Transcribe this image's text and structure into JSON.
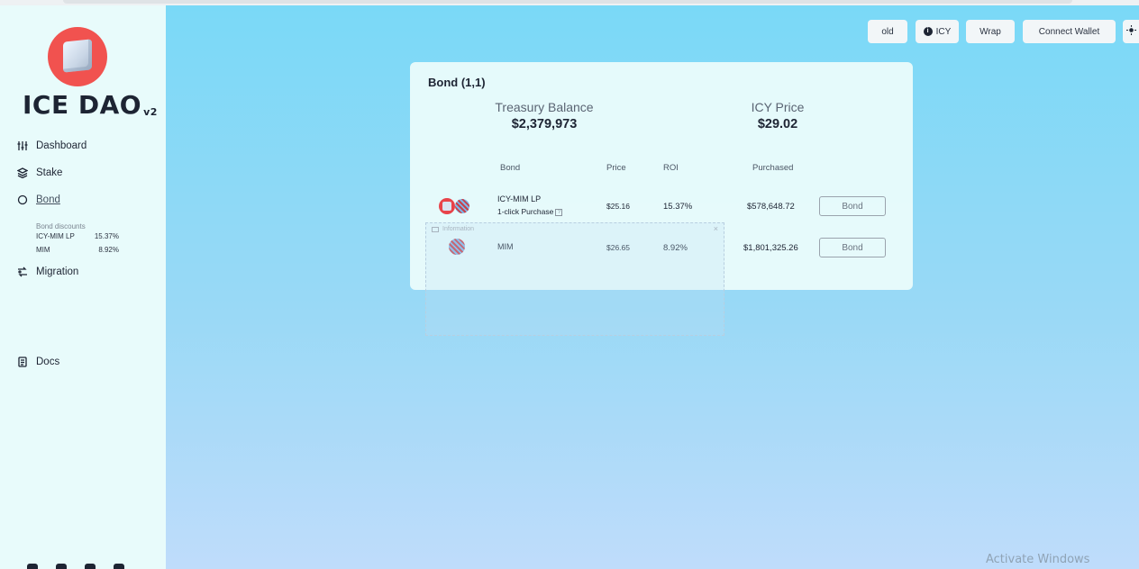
{
  "brand": {
    "name": "ICE DAO",
    "version": "v2"
  },
  "nav": {
    "dashboard": "Dashboard",
    "stake": "Stake",
    "bond": "Bond",
    "migration": "Migration",
    "docs": "Docs"
  },
  "bond_discounts": {
    "title": "Bond discounts",
    "items": [
      {
        "name": "ICY-MIM LP",
        "value": "15.37%"
      },
      {
        "name": "MIM",
        "value": "8.92%"
      }
    ]
  },
  "topbar": {
    "old": "old",
    "icy": "ICY",
    "wrap": "Wrap",
    "connect": "Connect Wallet"
  },
  "card": {
    "title": "Bond (1,1)",
    "treasury_label": "Treasury Balance",
    "treasury_value": "$2,379,973",
    "price_label": "ICY Price",
    "price_value": "$29.02",
    "headers": {
      "bond": "Bond",
      "price": "Price",
      "roi": "ROI",
      "purchased": "Purchased"
    },
    "rows": [
      {
        "name": "ICY-MIM LP",
        "sub": "1-click Purchase",
        "price": "$25.16",
        "roi": "15.37%",
        "purchased": "$578,648.72",
        "action": "Bond"
      },
      {
        "name": "MIM",
        "sub": "",
        "price": "$26.65",
        "roi": "8.92%",
        "purchased": "$1,801,325.26",
        "action": "Bond"
      }
    ]
  },
  "overlay": {
    "title": "Information",
    "close": "×"
  },
  "watermark": "Activate Windows"
}
